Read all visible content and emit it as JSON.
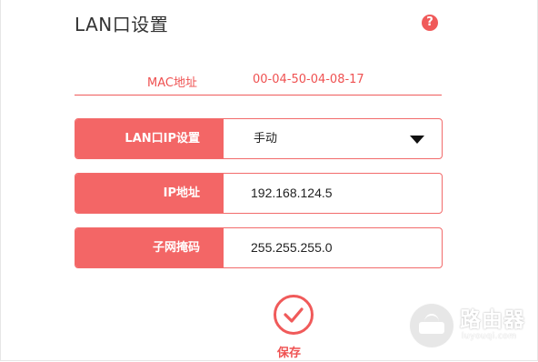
{
  "page": {
    "title": "LAN口设置",
    "help_icon": "question-circle-icon"
  },
  "mac": {
    "label": "MAC地址",
    "value": "00-04-50-04-08-17"
  },
  "fields": [
    {
      "label": "LAN口IP设置",
      "value": "手动",
      "type": "select"
    },
    {
      "label": "IP地址",
      "value": "192.168.124.5",
      "type": "text"
    },
    {
      "label": "子网掩码",
      "value": "255.255.255.0",
      "type": "text"
    }
  ],
  "save": {
    "label": "保存",
    "icon": "checkmark-circle-icon"
  },
  "watermark": {
    "title": "路由器",
    "url": "luyouqi.com"
  },
  "colors": {
    "accent": "#f05a5a",
    "label_bg": "#f36666",
    "text": "#333333"
  }
}
